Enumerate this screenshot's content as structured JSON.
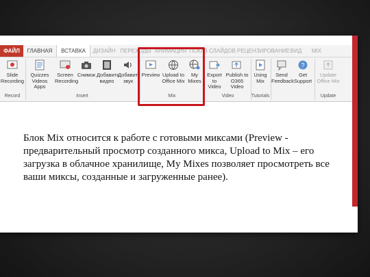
{
  "ribbon": {
    "tabs": [
      {
        "label": "ФАЙЛ"
      },
      {
        "label": "ГЛАВНАЯ"
      },
      {
        "label": "ВСТАВКА"
      },
      {
        "label": "ДИЗАЙН"
      },
      {
        "label": "ПЕРЕХОДЫ"
      },
      {
        "label": "АНИМАЦИЯ"
      },
      {
        "label": "ПОКАЗ СЛАЙДОВ"
      },
      {
        "label": "РЕЦЕНЗИРОВАНИЕ"
      },
      {
        "label": "ВИД"
      },
      {
        "label": "MIX"
      }
    ],
    "record_group": {
      "label": "Record",
      "slide_recording": "Slide\nRecording"
    },
    "insert_group": {
      "label": "Insert",
      "quizzes": "Quizzes\nVideos Apps",
      "screen_recording": "Screen\nRecording",
      "snapshot": "Снимок",
      "add_video": "Добавить\nвидео",
      "add_audio": "Добавить\nзвук"
    },
    "mix_group": {
      "label": "Mix",
      "preview": "Preview",
      "upload": "Upload to\nOffice Mix",
      "my_mixes": "My\nMixes"
    },
    "video_group": {
      "label": "Video",
      "export": "Export\nto Video",
      "publish": "Publish to\nO365 Video"
    },
    "tutorials_group": {
      "label": "Tutorials",
      "using_mix": "Using\nMix"
    },
    "feedback_group": {
      "send_feedback": "Send\nFeedback",
      "get_support": "Get\nSupport"
    },
    "update_group": {
      "label": "Update",
      "update_office_mix": "Update\nOffice Mix"
    }
  },
  "caption": "Блок Mix относится к работе с готовыми миксами (Preview - предварительный просмотр созданного микса, Upload to Mix – его загрузка в облачное хранилище, My Mixes позволяет просмотреть все ваши миксы, созданные и загруженные ранее).",
  "colors": {
    "accent_red": "#c1272d",
    "highlight": "#c8161d",
    "file_tab": "#c0392b"
  }
}
